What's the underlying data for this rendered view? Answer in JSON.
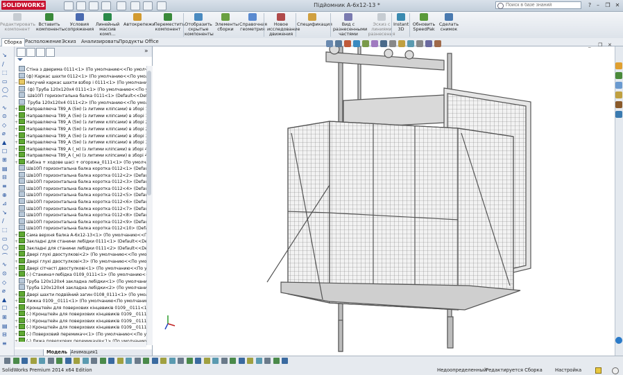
{
  "app": {
    "brand": "SOLIDWORKS",
    "doc_title": "Підйомник А-6х12-13 *"
  },
  "search": {
    "placeholder": "Поиск в базе знаний"
  },
  "ribbon": [
    {
      "label": "Редактировать компонент",
      "disabled": true
    },
    {
      "label": "Вставить компоненты",
      "disabled": false
    },
    {
      "label": "Условия сопряжения",
      "disabled": false
    },
    {
      "label": "Линейный массив комп...",
      "disabled": false
    },
    {
      "label": "Автокрепежи",
      "disabled": false
    },
    {
      "label": "Переместить компонент",
      "disabled": false
    },
    {
      "label": "Отобразить скрытые компоненты",
      "disabled": false
    },
    {
      "label": "Элементы сборки",
      "disabled": false
    },
    {
      "label": "Справочная геометрия",
      "disabled": false
    },
    {
      "label": "Новое исследование движения",
      "disabled": false
    },
    {
      "label": "Спецификация",
      "disabled": false
    },
    {
      "label": "Вид с разнесенными частями",
      "disabled": false
    },
    {
      "label": "Эскиз с линиями разнесения",
      "disabled": true
    },
    {
      "label": "Instant 3D",
      "disabled": false
    },
    {
      "label": "Обновить SpeedPak",
      "disabled": false
    },
    {
      "label": "Сделать снимок",
      "disabled": false
    }
  ],
  "command_tabs": [
    "Сборка",
    "Расположение",
    "Эскиз",
    "Анализировать",
    "Продукты Office"
  ],
  "tree": [
    {
      "exp": "",
      "icon": "part",
      "text": "Стіна з дверима 0111<1> (По умолчанию<<По умолча"
    },
    {
      "exp": "",
      "icon": "part",
      "text": "(ф) Каркас шахти 0112<1> (По умолчанию<<По умолча"
    },
    {
      "exp": "−",
      "icon": "fld",
      "text": "Несучий каркас шахти взбор і 0111<1> (По умолчанию<"
    },
    {
      "exp": "",
      "icon": "part",
      "text": "  (ф) Труба 120х120х4 0111<1> (По умолчанию<<По у"
    },
    {
      "exp": "",
      "icon": "part",
      "text": "  Шв10П горизонтальна балка 0111<1> (Default<<Defa"
    },
    {
      "exp": "",
      "icon": "part",
      "text": "  Труба 120х120х4 0111<2> (По умолчанию<<По умол"
    },
    {
      "exp": "+",
      "icon": "asm",
      "text": "Направляюча T89_A (5м) (з литими кліпсами) в зборі 1і"
    },
    {
      "exp": "+",
      "icon": "asm",
      "text": "Направляюча T89_A (5м) (з литими кліпсами) в зборі 1і"
    },
    {
      "exp": "+",
      "icon": "asm",
      "text": "Направляюча T89_A (5м) (з литими кліпсами) в зборі 2і"
    },
    {
      "exp": "+",
      "icon": "asm",
      "text": "Направляюча T89_A (5м) (з литими кліпсами) в зборі 2і"
    },
    {
      "exp": "+",
      "icon": "asm",
      "text": "Направляюча T89_A (5м) (з литими кліпсами) в зборі 3і"
    },
    {
      "exp": "+",
      "icon": "asm",
      "text": "Направляюча T89_A (5м) (з литими кліпсами) в зборі 3і"
    },
    {
      "exp": "+",
      "icon": "asm",
      "text": "Направляюча T89_A (_м) (з литими кліпсами) в зборі 4і"
    },
    {
      "exp": "+",
      "icon": "asm",
      "text": "Направляюча T89_A (_м) (з литими кліпсами) в зборі 4і"
    },
    {
      "exp": "+",
      "icon": "asm",
      "text": "Кабіна + ходове шасі + огорожа_0111<1> (По умолчани"
    },
    {
      "exp": "",
      "icon": "part",
      "text": "Шв10П горизонтальна балка коротка 0112<1> (Default<"
    },
    {
      "exp": "",
      "icon": "part",
      "text": "Шв10П горизонтальна балка коротка 0112<2> (Default<"
    },
    {
      "exp": "",
      "icon": "part",
      "text": "Шв10П горизонтальна балка коротка 0112<3> (Default<"
    },
    {
      "exp": "",
      "icon": "part",
      "text": "Шв10П горизонтальна балка коротка 0112<4> (Default<"
    },
    {
      "exp": "",
      "icon": "part",
      "text": "Шв10П горизонтальна балка коротка 0112<5> (Default<"
    },
    {
      "exp": "",
      "icon": "part",
      "text": "Шв10П горизонтальна балка коротка 0112<6> (Default<"
    },
    {
      "exp": "",
      "icon": "part",
      "text": "Шв10П горизонтальна балка коротка 0112<7> (Default<"
    },
    {
      "exp": "",
      "icon": "part",
      "text": "Шв10П горизонтальна балка коротка 0112<8> (Default<"
    },
    {
      "exp": "",
      "icon": "part",
      "text": "Шв10П горизонтальна балка коротка 0112<9> (Default<"
    },
    {
      "exp": "",
      "icon": "part",
      "text": "Шв10П горизонтальна балка коротка 0112<10> (Default<"
    },
    {
      "exp": "+",
      "icon": "asm",
      "text": "Сама верхня балка А-6х12-13<1> (По умолчанию<<По у"
    },
    {
      "exp": "+",
      "icon": "asm",
      "text": "Закладні для станини лебідки 0111<1> (Default<<Default"
    },
    {
      "exp": "+",
      "icon": "asm",
      "text": "Закладні для станини лебідки 0111<2> (Default<<Default"
    },
    {
      "exp": "+",
      "icon": "asm",
      "text": "Двері глухі двостулкові<2> (По умолчанию<<По умолча"
    },
    {
      "exp": "+",
      "icon": "asm",
      "text": "Двері глухі двостулкові<3> (По умолчанию<<По умолча"
    },
    {
      "exp": "+",
      "icon": "asm",
      "text": "Двері сітчасті двостулкові<1> (По умолчанию<<По умол"
    },
    {
      "exp": "+",
      "icon": "asm",
      "text": "(-) Станина+лебідка 0109_0111<1> (По умолчанию<<По"
    },
    {
      "exp": "",
      "icon": "part",
      "text": "Труба 120х120х4 закладна лебідки<1> (По умолчанию<<"
    },
    {
      "exp": "",
      "icon": "part",
      "text": "Труба 120х120х4 закладна лебідки<2> (По умолчанию<<"
    },
    {
      "exp": "+",
      "icon": "asm",
      "text": "Двері шахти подвійний загин 0108_0111<1> (По умолча"
    },
    {
      "exp": "+",
      "icon": "asm",
      "text": "Лижка 0109__0111<1> (По умолчанию<По умолчанию_С"
    },
    {
      "exp": "+",
      "icon": "asm",
      "text": "Кронштейн для поверхових кінцевиків 0109__0111<1> (П"
    },
    {
      "exp": "+",
      "icon": "asm",
      "text": "(-) Кронштейн для поверхових кінцевиків 0109__0111<2>"
    },
    {
      "exp": "+",
      "icon": "asm",
      "text": "(-) Кронштейн для поверхових кінцевиків 0109__0111<3>"
    },
    {
      "exp": "+",
      "icon": "asm",
      "text": "(-) Кронштейн для поверхових кінцевиків 0109__0111<4>"
    },
    {
      "exp": "+",
      "icon": "asm",
      "text": "(-) Поверховий перемикач<1> (По умолчанию<<По умол"
    },
    {
      "exp": "+",
      "icon": "asm",
      "text": "(-) Лижа поверхових перемикачів<1> (По умолчанию<<"
    }
  ],
  "bottom_tabs": [
    "Модель",
    "Анимация1"
  ],
  "status": {
    "app_edition": "SolidWorks Premium 2014 x64 Edition",
    "field1": "Недоопределенный",
    "field2": "Редактируется Сборка",
    "field3": "Настройка"
  },
  "colors": {
    "brand_red": "#c8102e",
    "frame_gray": "#6e6e6e",
    "ribbon_bg": "#e4e9ef"
  }
}
